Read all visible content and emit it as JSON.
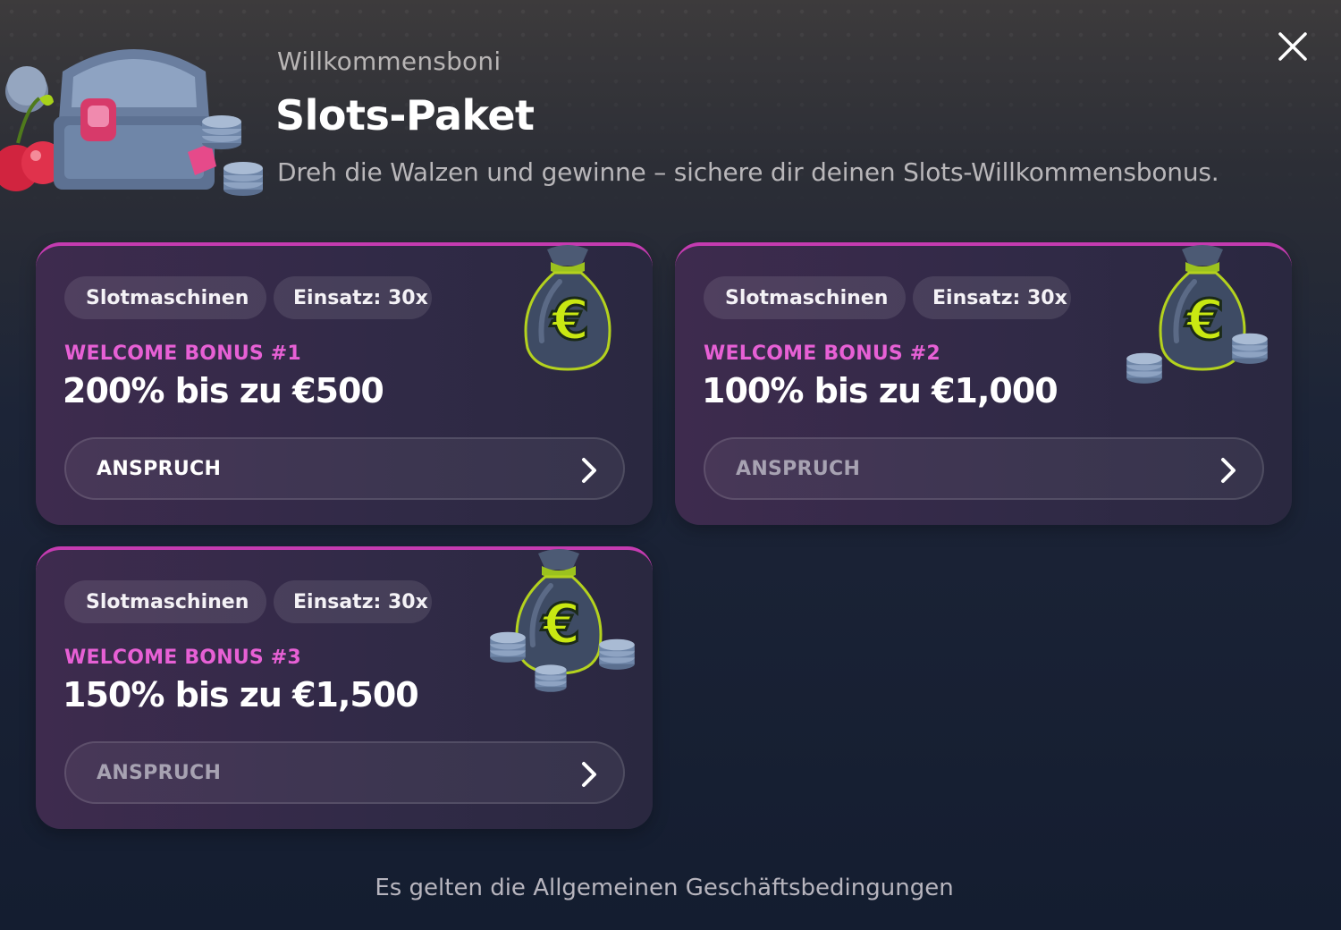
{
  "header": {
    "subtitle": "Willkommensboni",
    "title": "Slots-Paket",
    "description": "Dreh die Walzen und gewinne – sichere dir deinen Slots-Willkommensbonus.",
    "close_icon": "close-icon",
    "illustration": "treasure-chest-icon"
  },
  "colors": {
    "accent": "#c43bb0",
    "bonus_label": "#e760d5",
    "background": "#141d30"
  },
  "bonuses": [
    {
      "category": "Slotmaschinen",
      "category_icon": "slot-machine-icon",
      "wager": "Einsatz: 30x",
      "label": "WELCOME BONUS #1",
      "amount": "200% bis zu €500",
      "button": "ANSPRUCH",
      "button_icon": "chevron-right-icon",
      "illustration": "money-bag-icon"
    },
    {
      "category": "Slotmaschinen",
      "category_icon": "slot-machine-icon",
      "wager": "Einsatz: 30x",
      "label": "WELCOME BONUS #2",
      "amount": "100% bis zu €1,000",
      "button": "ANSPRUCH",
      "button_icon": "chevron-right-icon",
      "illustration": "money-bag-icon"
    },
    {
      "category": "Slotmaschinen",
      "category_icon": "slot-machine-icon",
      "wager": "Einsatz: 30x",
      "label": "WELCOME BONUS #3",
      "amount": "150% bis zu €1,500",
      "button": "ANSPRUCH",
      "button_icon": "chevron-right-icon",
      "illustration": "money-bag-icon"
    }
  ],
  "footer": {
    "terms": "Es gelten die Allgemeinen Geschäftsbedingungen"
  }
}
